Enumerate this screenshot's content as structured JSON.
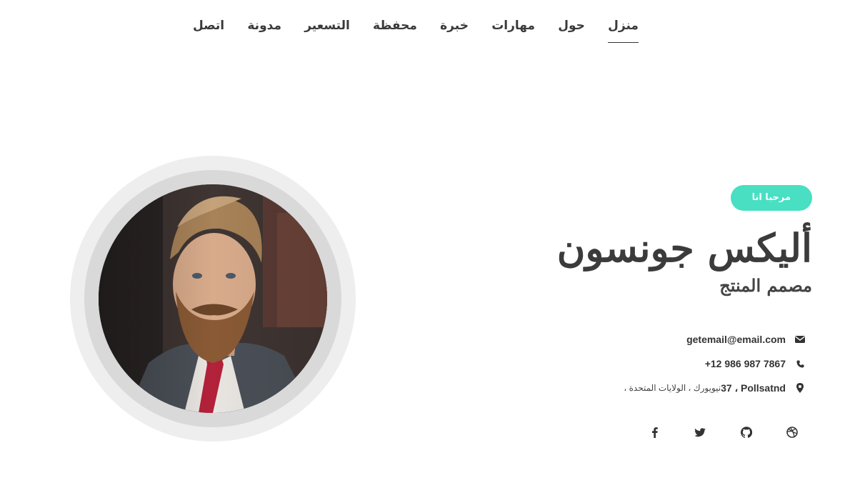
{
  "nav": {
    "items": [
      {
        "label": "منزل",
        "active": true
      },
      {
        "label": "حول"
      },
      {
        "label": "مهارات"
      },
      {
        "label": "خبرة"
      },
      {
        "label": "محفظة"
      },
      {
        "label": "التسعير"
      },
      {
        "label": "مدونة"
      },
      {
        "label": "اتصل"
      }
    ]
  },
  "hero": {
    "badge": "مرحبا انا",
    "name": "أليكس جونسون",
    "role": "مصمم المنتج"
  },
  "contact": {
    "email": "getemail@email.com",
    "phone": "+12 986 987 7867",
    "address_main": "37 ، Pollsatnd",
    "address_extra": "، نيويورك ، الولايات المتحدة"
  },
  "social": [
    "facebook-icon",
    "twitter-icon",
    "github-icon",
    "dribbble-icon"
  ],
  "colors": {
    "accent": "#48dfc3",
    "text": "#3b3b3b",
    "ring_outer": "#eeeeee",
    "ring_inner": "#d9d9d9"
  }
}
